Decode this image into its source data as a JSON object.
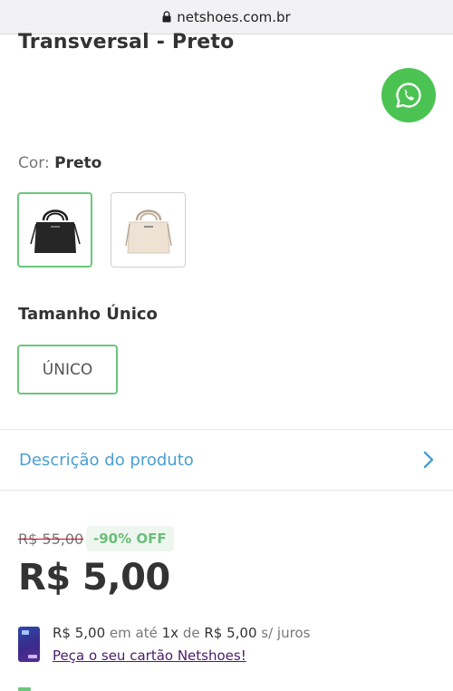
{
  "browser": {
    "url": "netshoes.com.br"
  },
  "product": {
    "title": "Transversal - Preto"
  },
  "color": {
    "label": "Cor:",
    "selected": "Preto",
    "options": [
      {
        "name": "bag-black",
        "selected": true
      },
      {
        "name": "bag-cream",
        "selected": false
      }
    ]
  },
  "size": {
    "title": "Tamanho Único",
    "option": "ÚNICO"
  },
  "description": {
    "label": "Descrição do produto"
  },
  "pricing": {
    "old_price": "R$ 55,00",
    "discount": "-90% OFF",
    "price": "R$ 5,00",
    "installment_amount": "R$ 5,00",
    "installment_prefix": "em até",
    "installment_count": "1x",
    "installment_mid": "de",
    "installment_value": "R$ 5,00",
    "installment_suffix": "s/ juros",
    "card_link": "Peça o seu cartão Netshoes!"
  },
  "colors": {
    "accent_green": "#6ac77b",
    "whatsapp": "#4bc352",
    "link_blue": "#4a9fd0",
    "card_purple": "#4a1d6b"
  },
  "icons": {
    "lock": "lock-icon",
    "whatsapp": "whatsapp-icon",
    "chevron": "chevron-right-icon",
    "card": "credit-card-icon"
  }
}
